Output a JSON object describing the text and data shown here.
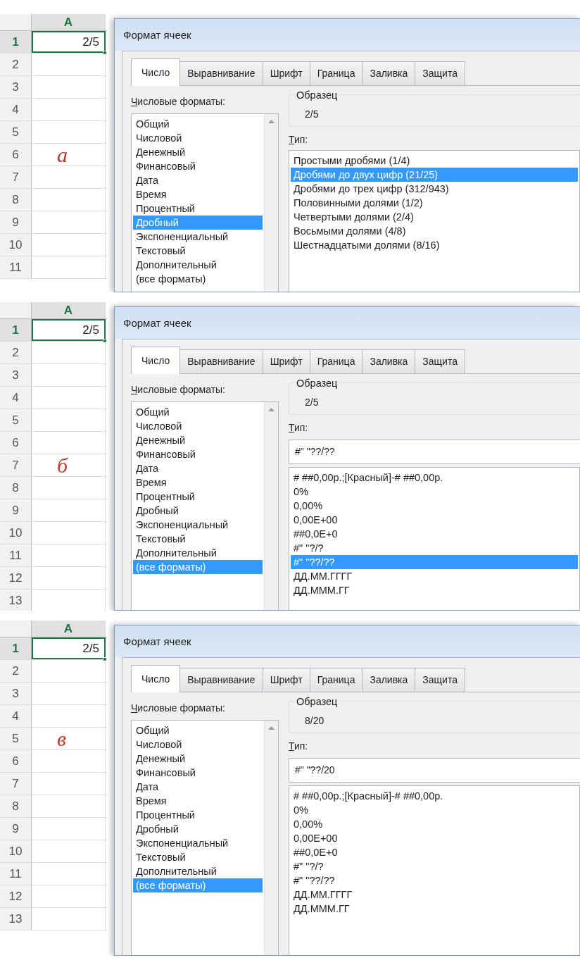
{
  "panels": [
    {
      "column": "A",
      "rows": [
        {
          "number": "1",
          "value": "2/5",
          "selected": true
        },
        {
          "number": "2",
          "selected": false
        },
        {
          "number": "3",
          "selected": false
        },
        {
          "number": "4",
          "selected": false
        },
        {
          "number": "5",
          "selected": false
        },
        {
          "number": "6",
          "selected": false,
          "note": "а"
        },
        {
          "number": "7",
          "selected": false
        },
        {
          "number": "8",
          "selected": false
        },
        {
          "number": "9",
          "selected": false
        },
        {
          "number": "10",
          "selected": false
        },
        {
          "number": "11",
          "selected": false
        }
      ],
      "dialog": {
        "title": "Формат ячеек",
        "tabs": [
          {
            "label": "Число",
            "selected": true
          },
          {
            "label": "Выравнивание",
            "selected": false
          },
          {
            "label": "Шрифт",
            "selected": false
          },
          {
            "label": "Граница",
            "selected": false
          },
          {
            "label": "Заливка",
            "selected": false
          },
          {
            "label": "Защита",
            "selected": false
          }
        ],
        "categories_label": "Числовые форматы:",
        "categories": [
          {
            "label": "Общий",
            "selected": false
          },
          {
            "label": "Числовой",
            "selected": false
          },
          {
            "label": "Денежный",
            "selected": false
          },
          {
            "label": "Финансовый",
            "selected": false
          },
          {
            "label": "Дата",
            "selected": false
          },
          {
            "label": "Время",
            "selected": false
          },
          {
            "label": "Процентный",
            "selected": false
          },
          {
            "label": "Дробный",
            "selected": true
          },
          {
            "label": "Экспоненциальный",
            "selected": false
          },
          {
            "label": "Текстовый",
            "selected": false
          },
          {
            "label": "Дополнительный",
            "selected": false
          },
          {
            "label": "(все форматы)",
            "selected": false
          }
        ],
        "sample_label": "Образец",
        "sample": "2/5",
        "type_label": "Тип:",
        "types": [
          {
            "label": "Простыми дробями (1/4)",
            "selected": false
          },
          {
            "label": "Дробями до двух цифр (21/25)",
            "selected": true
          },
          {
            "label": "Дробями до трех цифр (312/943)",
            "selected": false
          },
          {
            "label": "Половинными долями (1/2)",
            "selected": false
          },
          {
            "label": "Четвертыми долями (2/4)",
            "selected": false
          },
          {
            "label": "Восьмыми долями (4/8)",
            "selected": false
          },
          {
            "label": "Шестнадцатыми долями (8/16)",
            "selected": false
          }
        ]
      }
    },
    {
      "column": "A",
      "rows": [
        {
          "number": "1",
          "value": "2/5",
          "selected": true
        },
        {
          "number": "2",
          "selected": false
        },
        {
          "number": "3",
          "selected": false
        },
        {
          "number": "4",
          "selected": false
        },
        {
          "number": "5",
          "selected": false
        },
        {
          "number": "6",
          "selected": false
        },
        {
          "number": "7",
          "selected": false,
          "note": "б"
        },
        {
          "number": "8",
          "selected": false
        },
        {
          "number": "9",
          "selected": false
        },
        {
          "number": "10",
          "selected": false
        },
        {
          "number": "11",
          "selected": false
        },
        {
          "number": "12",
          "selected": false
        },
        {
          "number": "13",
          "selected": false
        }
      ],
      "dialog": {
        "title": "Формат ячеек",
        "tabs": [
          {
            "label": "Число",
            "selected": true
          },
          {
            "label": "Выравнивание",
            "selected": false
          },
          {
            "label": "Шрифт",
            "selected": false
          },
          {
            "label": "Граница",
            "selected": false
          },
          {
            "label": "Заливка",
            "selected": false
          },
          {
            "label": "Защита",
            "selected": false
          }
        ],
        "categories_label": "Числовые форматы:",
        "categories": [
          {
            "label": "Общий",
            "selected": false
          },
          {
            "label": "Числовой",
            "selected": false
          },
          {
            "label": "Денежный",
            "selected": false
          },
          {
            "label": "Финансовый",
            "selected": false
          },
          {
            "label": "Дата",
            "selected": false
          },
          {
            "label": "Время",
            "selected": false
          },
          {
            "label": "Процентный",
            "selected": false
          },
          {
            "label": "Дробный",
            "selected": false
          },
          {
            "label": "Экспоненциальный",
            "selected": false
          },
          {
            "label": "Текстовый",
            "selected": false
          },
          {
            "label": "Дополнительный",
            "selected": false
          },
          {
            "label": "(все форматы)",
            "selected": true
          }
        ],
        "sample_label": "Образец",
        "sample": "2/5",
        "type_label": "Тип:",
        "type_value": "#\" \"??/??",
        "types": [
          {
            "label": "# ##0,00р.;[Красный]-# ##0,00р.",
            "selected": false
          },
          {
            "label": "0%",
            "selected": false
          },
          {
            "label": "0,00%",
            "selected": false
          },
          {
            "label": "0,00E+00",
            "selected": false
          },
          {
            "label": "##0,0E+0",
            "selected": false
          },
          {
            "label": "#\" \"?/?",
            "selected": false
          },
          {
            "label": "#\" \"??/??",
            "selected": true
          },
          {
            "label": "ДД.ММ.ГГГГ",
            "selected": false
          },
          {
            "label": "ДД.МММ.ГГ",
            "selected": false
          }
        ]
      }
    },
    {
      "column": "A",
      "rows": [
        {
          "number": "1",
          "value": "2/5",
          "selected": true
        },
        {
          "number": "2",
          "selected": false
        },
        {
          "number": "3",
          "selected": false
        },
        {
          "number": "4",
          "selected": false
        },
        {
          "number": "5",
          "selected": false,
          "note": "в"
        },
        {
          "number": "6",
          "selected": false
        },
        {
          "number": "7",
          "selected": false
        },
        {
          "number": "8",
          "selected": false
        },
        {
          "number": "9",
          "selected": false
        },
        {
          "number": "10",
          "selected": false
        },
        {
          "number": "11",
          "selected": false
        },
        {
          "number": "12",
          "selected": false
        },
        {
          "number": "13",
          "selected": false
        }
      ],
      "dialog": {
        "title": "Формат ячеек",
        "tabs": [
          {
            "label": "Число",
            "selected": true
          },
          {
            "label": "Выравнивание",
            "selected": false
          },
          {
            "label": "Шрифт",
            "selected": false
          },
          {
            "label": "Граница",
            "selected": false
          },
          {
            "label": "Заливка",
            "selected": false
          },
          {
            "label": "Защита",
            "selected": false
          }
        ],
        "categories_label": "Числовые форматы:",
        "categories": [
          {
            "label": "Общий",
            "selected": false
          },
          {
            "label": "Числовой",
            "selected": false
          },
          {
            "label": "Денежный",
            "selected": false
          },
          {
            "label": "Финансовый",
            "selected": false
          },
          {
            "label": "Дата",
            "selected": false
          },
          {
            "label": "Время",
            "selected": false
          },
          {
            "label": "Процентный",
            "selected": false
          },
          {
            "label": "Дробный",
            "selected": false
          },
          {
            "label": "Экспоненциальный",
            "selected": false
          },
          {
            "label": "Текстовый",
            "selected": false
          },
          {
            "label": "Дополнительный",
            "selected": false
          },
          {
            "label": "(все форматы)",
            "selected": true
          }
        ],
        "sample_label": "Образец",
        "sample": "8/20",
        "type_label": "Тип:",
        "type_value": "#\" \"??/20",
        "types": [
          {
            "label": "# ##0,00р.;[Красный]-# ##0,00р.",
            "selected": false
          },
          {
            "label": "0%",
            "selected": false
          },
          {
            "label": "0,00%",
            "selected": false
          },
          {
            "label": "0,00E+00",
            "selected": false
          },
          {
            "label": "##0,0E+0",
            "selected": false
          },
          {
            "label": "#\" \"?/?",
            "selected": false
          },
          {
            "label": "#\" \"??/??",
            "selected": false
          },
          {
            "label": "ДД.ММ.ГГГГ",
            "selected": false
          },
          {
            "label": "ДД.МММ.ГГ",
            "selected": false
          }
        ]
      }
    }
  ]
}
